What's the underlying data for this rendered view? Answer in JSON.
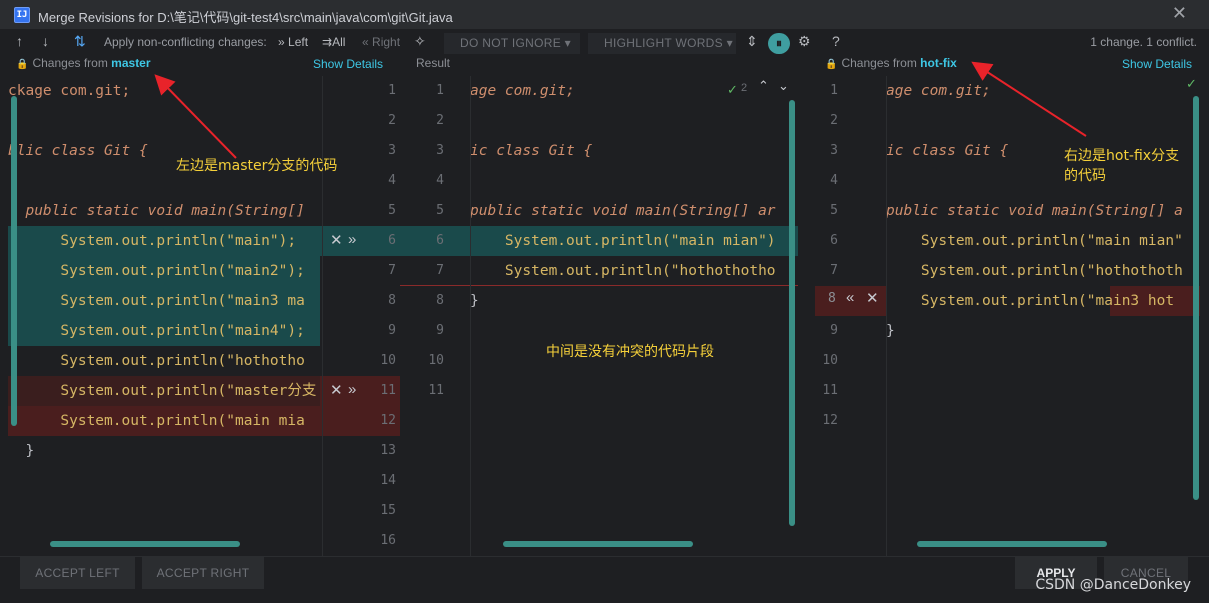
{
  "window": {
    "title": "Merge Revisions for D:\\笔记\\代码\\git-test4\\src\\main\\java\\com\\git\\Git.java",
    "close_icon": "close-icon"
  },
  "toolbar": {
    "apply_label": "Apply non-conflicting changes:",
    "left_label": "Left",
    "all_label": "All",
    "right_label": "Right",
    "ignore_dropdown": "DO NOT IGNORE",
    "highlight_dropdown": "HIGHLIGHT WORDS",
    "help": "?",
    "status": "1 change. 1 conflict."
  },
  "headers": {
    "left_prefix": "Changes from",
    "left_branch": "master",
    "left_show_details": "Show Details",
    "result": "Result",
    "right_prefix": "Changes from",
    "right_branch": "hot-fix",
    "right_show_details": "Show Details",
    "mid_count": "2"
  },
  "left_lines": [
    "ckage com.git;",
    "",
    "blic class Git {",
    "",
    "  public static void main(String[]",
    "      System.out.println(\"main\");",
    "      System.out.println(\"main2\");",
    "      System.out.println(\"main3 ma",
    "      System.out.println(\"main4\");",
    "      System.out.println(\"hothotho",
    "      System.out.println(\"master分支",
    "      System.out.println(\"main mia",
    "  }"
  ],
  "left_gutter": [
    "1",
    "2",
    "3",
    "4",
    "5",
    "6",
    "7",
    "8",
    "9",
    "10",
    "11",
    "12",
    "13",
    "14",
    "15",
    "16"
  ],
  "mid_gutter": [
    "1",
    "2",
    "3",
    "4",
    "5",
    "6",
    "7",
    "8",
    "9",
    "10",
    "11"
  ],
  "mid_lines": [
    "age com.git;",
    "",
    "ic class Git {",
    "",
    "public static void main(String[] ar",
    "    System.out.println(\"main mian\")",
    "    System.out.println(\"hothothotho",
    "}"
  ],
  "right_gutter": [
    "1",
    "2",
    "3",
    "4",
    "5",
    "6",
    "7",
    "8",
    "9",
    "10",
    "11",
    "12"
  ],
  "right_lines": [
    "age com.git;",
    "",
    "ic class Git {",
    "",
    "public static void main(String[] a",
    "    System.out.println(\"main mian\"",
    "    System.out.println(\"hothothoth",
    "    System.out.println(\"main3 hot",
    "}"
  ],
  "annotations": {
    "left": "左边是master分支的代码",
    "right": "右边是hot-fix分支\n的代码",
    "middle": "中间是没有冲突的代码片段"
  },
  "buttons": {
    "accept_left": "ACCEPT LEFT",
    "accept_right": "ACCEPT RIGHT",
    "apply": "APPLY",
    "cancel": "CANCEL"
  },
  "watermark": "CSDN @DanceDonkey",
  "colors": {
    "accent": "#3ec7e5",
    "change_band": "#1a4a4b",
    "conflict_band": "#4a1e1e",
    "annotation": "#f5d03a",
    "arrow": "#e8232a"
  }
}
